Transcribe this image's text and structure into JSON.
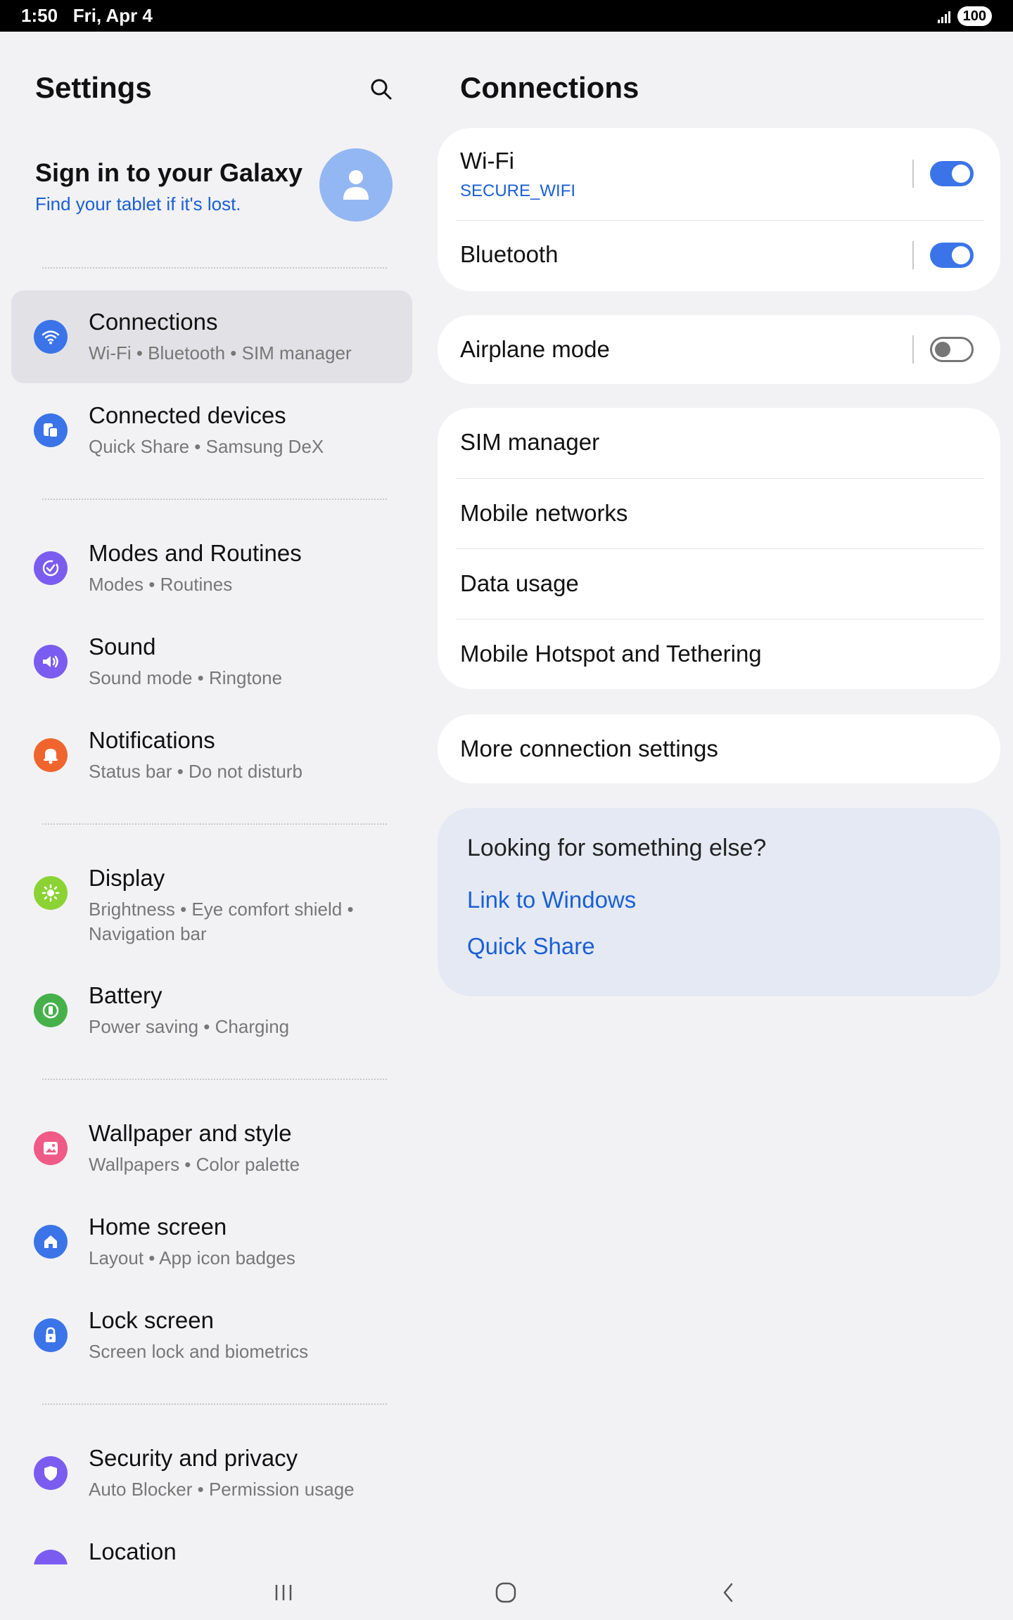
{
  "status_bar": {
    "time": "1:50",
    "date": "Fri, Apr 4",
    "battery": "100"
  },
  "left_pane": {
    "title": "Settings",
    "signin": {
      "title": "Sign in to your Galaxy",
      "subtitle": "Find your tablet if it's lost."
    },
    "items": [
      {
        "title": "Connections",
        "subtitle": "Wi-Fi  •  Bluetooth  •  SIM manager",
        "icon": "wifi-icon",
        "color": "#3b74e8",
        "selected": true
      },
      {
        "title": "Connected devices",
        "subtitle": "Quick Share  •  Samsung DeX",
        "icon": "devices-icon",
        "color": "#3b74e8"
      },
      {
        "title": "Modes and Routines",
        "subtitle": "Modes  •  Routines",
        "icon": "routines-icon",
        "color": "#7b5cf0"
      },
      {
        "title": "Sound",
        "subtitle": "Sound mode  •  Ringtone",
        "icon": "volume-icon",
        "color": "#7b5cf0"
      },
      {
        "title": "Notifications",
        "subtitle": "Status bar  •  Do not disturb",
        "icon": "bell-icon",
        "color": "#f0652d"
      },
      {
        "title": "Display",
        "subtitle": "Brightness  •  Eye comfort shield  •  Navigation bar",
        "icon": "sun-icon",
        "color": "#8bd334"
      },
      {
        "title": "Battery",
        "subtitle": "Power saving  •  Charging",
        "icon": "battery-icon",
        "color": "#46b14a"
      },
      {
        "title": "Wallpaper and style",
        "subtitle": "Wallpapers  •  Color palette",
        "icon": "image-icon",
        "color": "#ef5b86"
      },
      {
        "title": "Home screen",
        "subtitle": "Layout  •  App icon badges",
        "icon": "home-icon",
        "color": "#3b74e8"
      },
      {
        "title": "Lock screen",
        "subtitle": "Screen lock and biometrics",
        "icon": "lock-icon",
        "color": "#3b74e8"
      },
      {
        "title": "Security and privacy",
        "subtitle": "Auto Blocker  •  Permission usage",
        "icon": "shield-icon",
        "color": "#7b5cf0"
      },
      {
        "title": "Location",
        "subtitle": "",
        "icon": "location-icon",
        "color": "#7b5cf0"
      }
    ]
  },
  "right_pane": {
    "title": "Connections",
    "wifi": {
      "label": "Wi-Fi",
      "network": "SECURE_WIFI",
      "enabled": true
    },
    "bluetooth": {
      "label": "Bluetooth",
      "enabled": true
    },
    "airplane": {
      "label": "Airplane mode",
      "enabled": false
    },
    "network_items": [
      "SIM manager",
      "Mobile networks",
      "Data usage",
      "Mobile Hotspot and Tethering"
    ],
    "more": "More connection settings",
    "helper": {
      "title": "Looking for something else?",
      "links": [
        "Link to Windows",
        "Quick Share"
      ]
    }
  },
  "colors": {
    "accent": "#3b74e8",
    "link": "#1a5fd6",
    "background": "#f2f2f4"
  }
}
